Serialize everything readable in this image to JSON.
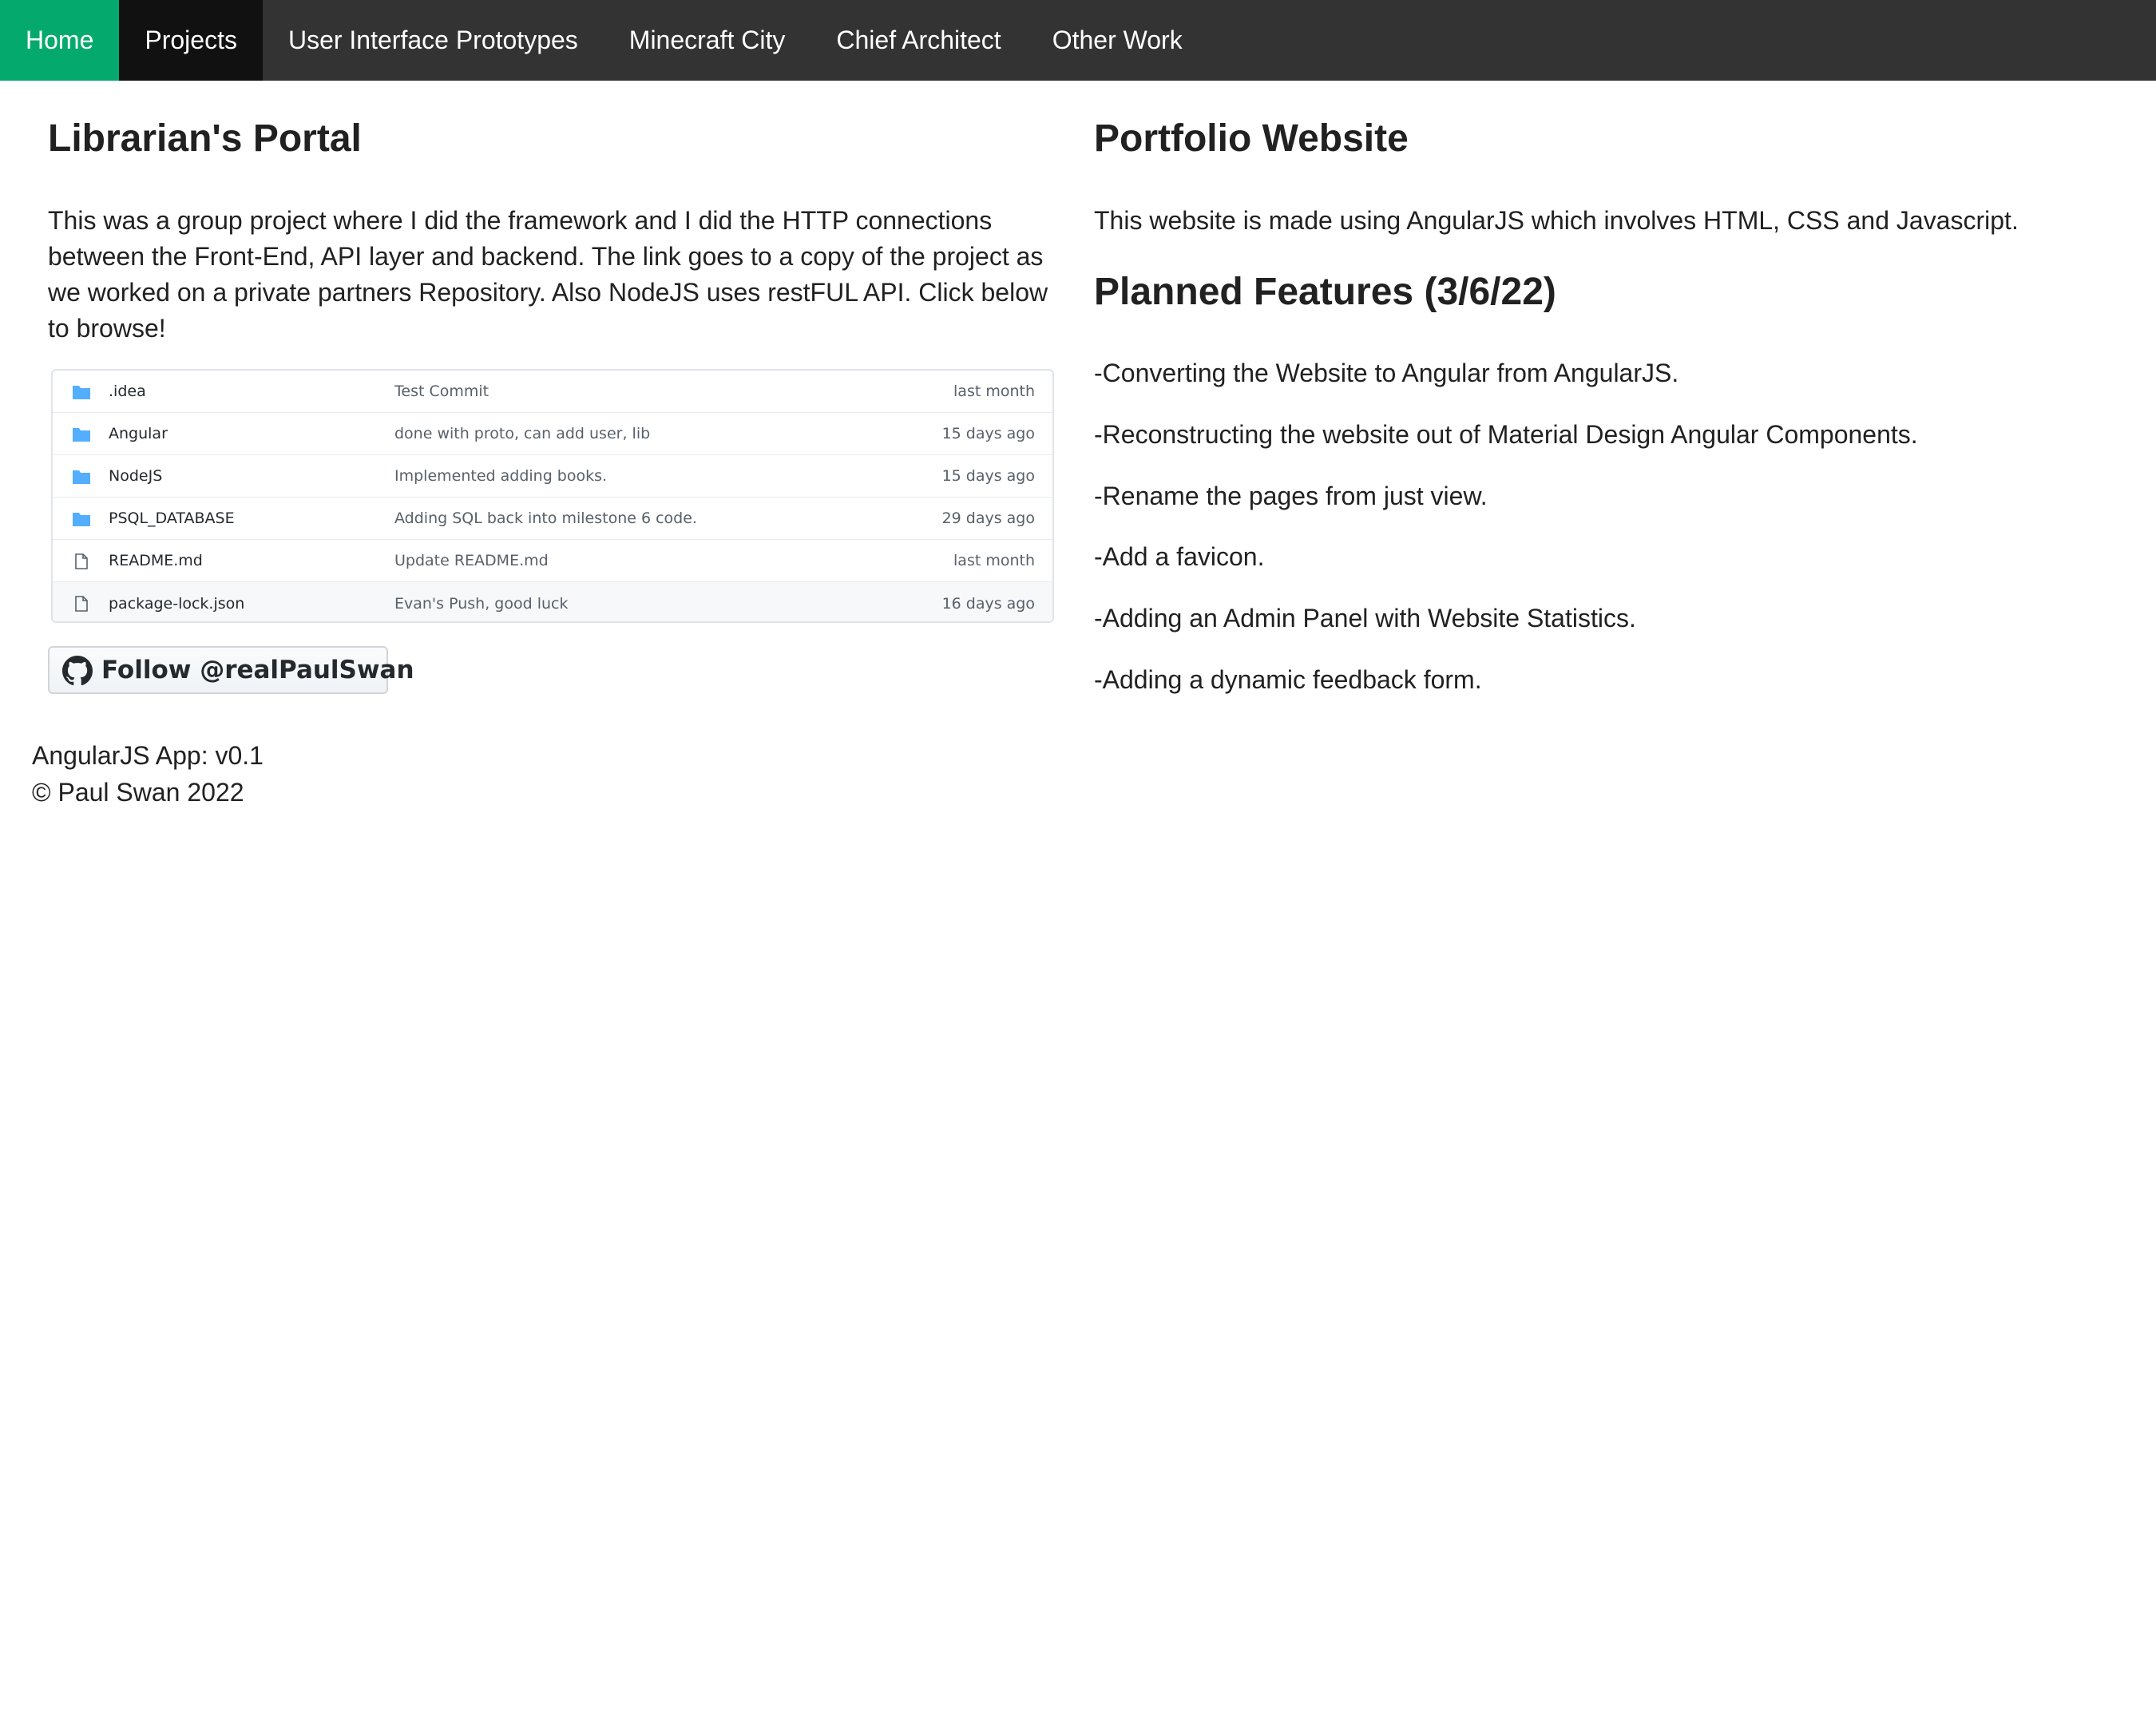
{
  "nav": {
    "items": [
      {
        "label": "Home"
      },
      {
        "label": "Projects"
      },
      {
        "label": "User Interface Prototypes"
      },
      {
        "label": "Minecraft City"
      },
      {
        "label": "Chief Architect"
      },
      {
        "label": "Other Work"
      }
    ],
    "active_item": "Projects",
    "home_color": "#04aa6d"
  },
  "left": {
    "title": "Librarian's Portal",
    "description": "This was a group project where I did the framework and I did the HTTP connections between the Front-End, API layer and backend. The link goes to a copy of the project as we worked on a private partners Repository. Also NodeJS uses restFUL API. Click below to browse!",
    "repo_files": [
      {
        "name": ".idea",
        "type": "folder",
        "message": "Test Commit",
        "age": "last month"
      },
      {
        "name": "Angular",
        "type": "folder",
        "message": "done with proto, can add user, lib",
        "age": "15 days ago"
      },
      {
        "name": "NodeJS",
        "type": "folder",
        "message": "Implemented adding books.",
        "age": "15 days ago"
      },
      {
        "name": "PSQL_DATABASE",
        "type": "folder",
        "message": "Adding SQL back into milestone 6 code.",
        "age": "29 days ago"
      },
      {
        "name": "README.md",
        "type": "file",
        "message": "Update README.md",
        "age": "last month"
      },
      {
        "name": "package-lock.json",
        "type": "file",
        "message": "Evan's Push, good luck",
        "age": "16 days ago"
      }
    ],
    "follow_button": "Follow @realPaulSwan"
  },
  "right": {
    "title": "Portfolio Website",
    "description": "This website is made using AngularJS which involves HTML, CSS and Javascript.",
    "features_title": "Planned Features (3/6/22)",
    "features": [
      "-Converting the Website to Angular from AngularJS.",
      "-Reconstructing the website out of Material Design Angular Components.",
      "-Rename the pages from just view.",
      "-Add a favicon.",
      "-Adding an Admin Panel with Website Statistics.",
      "-Adding a dynamic feedback form."
    ]
  },
  "footer": {
    "version": "AngularJS App: v0.1",
    "copyright": "© Paul Swan 2022"
  }
}
